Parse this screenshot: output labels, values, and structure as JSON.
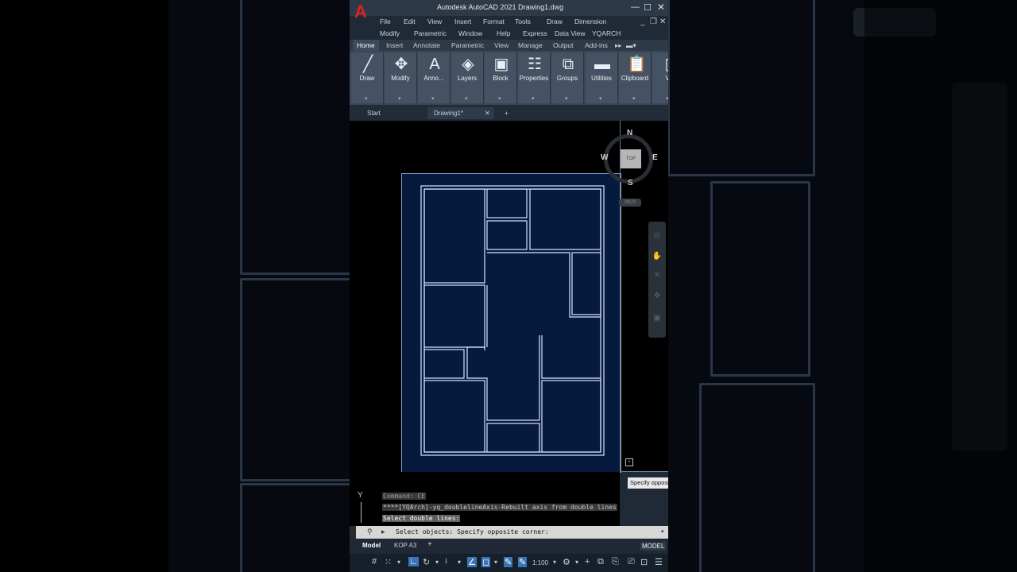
{
  "window": {
    "title": "Autodesk AutoCAD 2021   Drawing1.dwg",
    "logo": "A"
  },
  "menu": {
    "row1": [
      "File",
      "Edit",
      "View",
      "Insert",
      "Format",
      "Tools",
      "Draw",
      "Dimension"
    ],
    "row2": [
      "Modify",
      "Parametric",
      "Window",
      "Help",
      "Express",
      "Data View",
      "YQARCH"
    ]
  },
  "ribbon_tabs": [
    "Home",
    "Insert",
    "Annotate",
    "Parametric",
    "View",
    "Manage",
    "Output",
    "Add-ins"
  ],
  "ribbon_panels": [
    {
      "label": "Draw",
      "icon": "pencil-line-icon",
      "glyph": "╱"
    },
    {
      "label": "Modify",
      "icon": "move-arrows-icon",
      "glyph": "✥"
    },
    {
      "label": "Anno...",
      "icon": "text-a-icon",
      "glyph": "A"
    },
    {
      "label": "Layers",
      "icon": "layers-icon",
      "glyph": "◈"
    },
    {
      "label": "Block",
      "icon": "block-icon",
      "glyph": "▣"
    },
    {
      "label": "Properties",
      "icon": "properties-icon",
      "glyph": "☷"
    },
    {
      "label": "Groups",
      "icon": "groups-icon",
      "glyph": "⧉"
    },
    {
      "label": "Utilities",
      "icon": "utilities-ruler-icon",
      "glyph": "▬"
    },
    {
      "label": "Clipboard",
      "icon": "clipboard-icon",
      "glyph": "📋"
    },
    {
      "label": "Vi",
      "icon": "view-icon",
      "glyph": "▯"
    }
  ],
  "doc_tabs": {
    "start": "Start",
    "active": "Drawing1*",
    "close": "✕",
    "add": "+"
  },
  "viewcube": {
    "north": "N",
    "south": "S",
    "east": "E",
    "west": "W",
    "face": "TOP",
    "wcs": "WCS"
  },
  "tooltip": "Specify opposite corner:",
  "command_history": [
    "Command: CE",
    "****[YQArch]-yq_doublelineAxis-Rebuilt axis from double lines",
    "Select double lines:"
  ],
  "command_input": "Select objects: Specify opposite corner:",
  "ucs_label": "Y",
  "layout_tabs": [
    "Model",
    "KOP A3"
  ],
  "model_badge": "MODEL",
  "status": {
    "scale": "1:100"
  },
  "colors": {
    "sheet": "#061a3e",
    "wall": "#d8e6ff",
    "highlight": "#3a75b8"
  }
}
